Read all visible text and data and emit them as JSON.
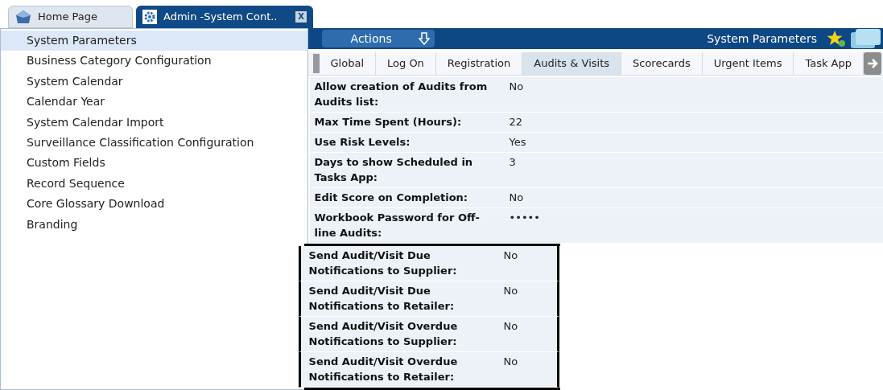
{
  "window_tabs": [
    {
      "label": "Home Page",
      "selected": false,
      "closable": false
    },
    {
      "label": "Admin -System Cont..",
      "selected": true,
      "closable": true
    }
  ],
  "close_glyph": "X",
  "sidebar": {
    "items": [
      {
        "label": "System Parameters",
        "selected": true
      },
      {
        "label": "Business Category Configuration",
        "selected": false
      },
      {
        "label": "System Calendar",
        "selected": false
      },
      {
        "label": "Calendar Year",
        "selected": false
      },
      {
        "label": "System Calendar Import",
        "selected": false
      },
      {
        "label": "Surveillance Classification Configuration",
        "selected": false
      },
      {
        "label": "Custom Fields",
        "selected": false
      },
      {
        "label": "Record Sequence",
        "selected": false
      },
      {
        "label": "Core Glossary Download",
        "selected": false
      },
      {
        "label": "Branding",
        "selected": false
      }
    ]
  },
  "header": {
    "actions_label": "Actions",
    "title": "System Parameters"
  },
  "tabs": [
    {
      "label": "Global",
      "selected": false
    },
    {
      "label": "Log On",
      "selected": false
    },
    {
      "label": "Registration",
      "selected": false
    },
    {
      "label": "Audits & Visits",
      "selected": true
    },
    {
      "label": "Scorecards",
      "selected": false
    },
    {
      "label": "Urgent Items",
      "selected": false
    },
    {
      "label": "Task App",
      "selected": false
    }
  ],
  "parameters": [
    {
      "label": "Allow creation of Audits from Audits list:",
      "value": "No",
      "highlighted": false
    },
    {
      "label": "Max Time Spent (Hours):",
      "value": "22",
      "highlighted": false
    },
    {
      "label": "Use Risk Levels:",
      "value": "Yes",
      "highlighted": false
    },
    {
      "label": "Days to show Scheduled in Tasks App:",
      "value": "3",
      "highlighted": false
    },
    {
      "label": "Edit Score on Completion:",
      "value": "No",
      "highlighted": false
    },
    {
      "label": "Workbook Password for Off-line Audits:",
      "value": "•••••",
      "highlighted": false
    },
    {
      "label": "Send Audit/Visit Due Notifications to Supplier:",
      "value": "No",
      "highlighted": true
    },
    {
      "label": "Send Audit/Visit Due Notifications to Retailer:",
      "value": "No",
      "highlighted": true
    },
    {
      "label": "Send Audit/Visit Overdue Notifications to Supplier:",
      "value": "No",
      "highlighted": true
    },
    {
      "label": "Send Audit/Visit Overdue Notifications to Retailer:",
      "value": "No",
      "highlighted": true
    }
  ]
}
